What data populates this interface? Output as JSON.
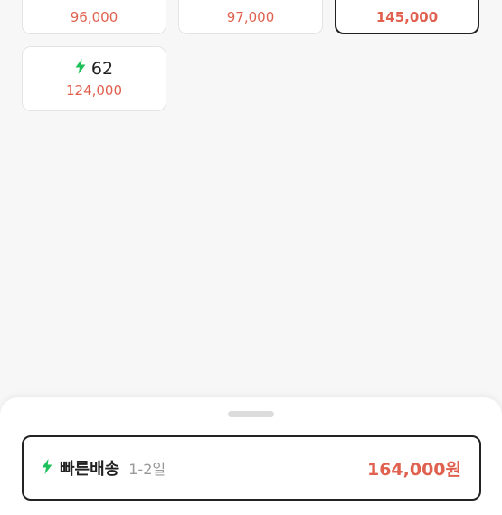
{
  "sizes": [
    {
      "size": "",
      "price": "96,000",
      "fast": false,
      "selected": false
    },
    {
      "size": "",
      "price": "97,000",
      "fast": false,
      "selected": false
    },
    {
      "size": "",
      "price": "145,000",
      "fast": false,
      "selected": true
    },
    {
      "size": "62",
      "price": "124,000",
      "fast": true,
      "selected": false
    }
  ],
  "delivery": {
    "label": "빠른배송",
    "days": "1-2일",
    "price": "164,000원"
  },
  "colors": {
    "price": "#e0614f",
    "fast_icon": "#1ec05a",
    "selected_border": "#222222"
  },
  "icons": {
    "fast": "lightning-bolt-icon"
  }
}
